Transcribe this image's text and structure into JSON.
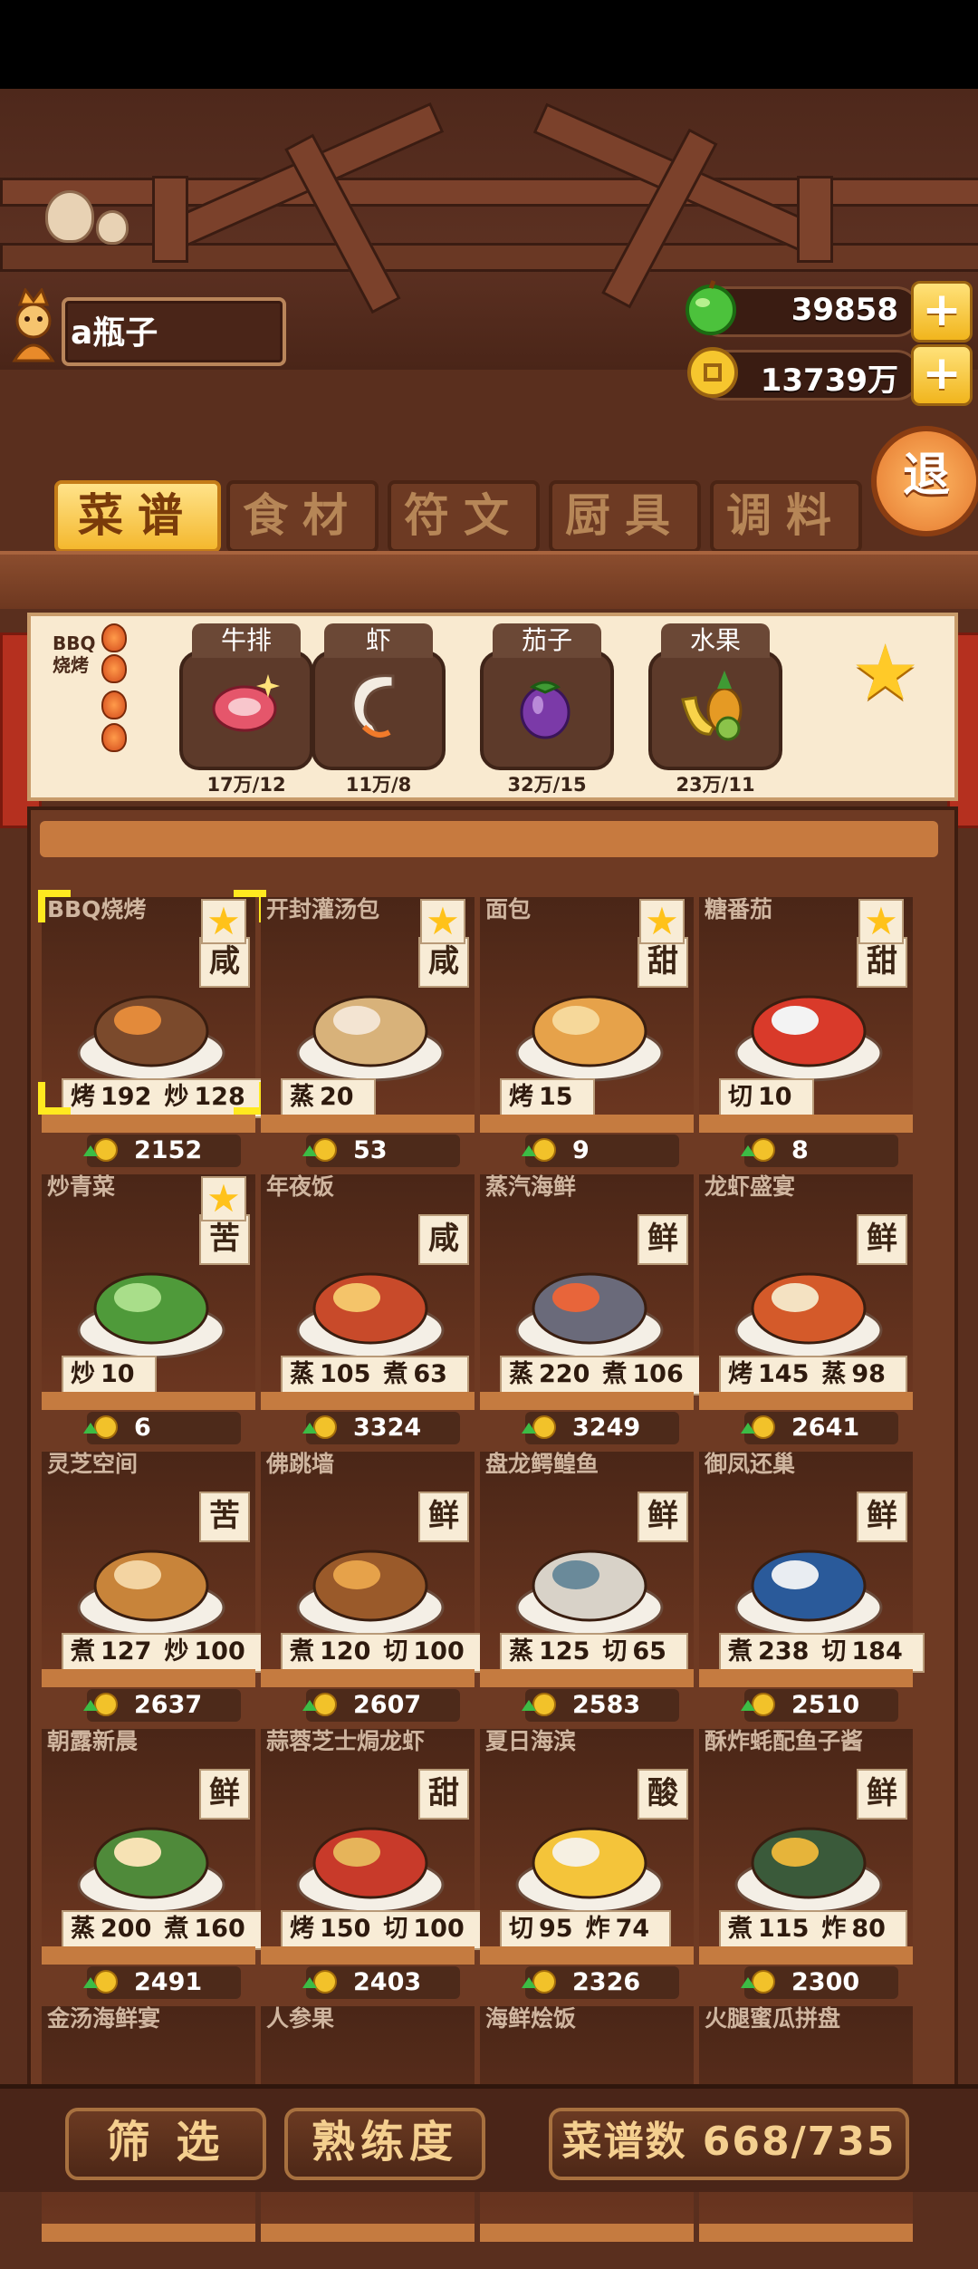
{
  "player": {
    "name": "a瓶子"
  },
  "currencies": {
    "gems": "39858",
    "coins": "13739万"
  },
  "exit_label": "退",
  "tabs": [
    {
      "label": "菜谱",
      "active": true
    },
    {
      "label": "食材",
      "active": false
    },
    {
      "label": "符文",
      "active": false
    },
    {
      "label": "厨具",
      "active": false
    },
    {
      "label": "调料",
      "active": false
    }
  ],
  "ingredient_panel": {
    "title_line1": "BBQ",
    "title_line2": "烧烤",
    "items": [
      {
        "name": "牛排",
        "count": "17万/12",
        "icon": "steak-icon"
      },
      {
        "name": "虾",
        "count": "11万/8",
        "icon": "shrimp-icon"
      },
      {
        "name": "茄子",
        "count": "32万/15",
        "icon": "eggplant-icon"
      },
      {
        "name": "水果",
        "count": "23万/11",
        "icon": "fruit-icon"
      }
    ]
  },
  "recipes": [
    {
      "name": "BBQ烧烤",
      "taste": "咸",
      "star": true,
      "skills": [
        [
          "烤",
          "192"
        ],
        [
          "炒",
          "128"
        ]
      ],
      "price": "2152",
      "selected": true
    },
    {
      "name": "开封灌汤包",
      "taste": "咸",
      "star": true,
      "skills": [
        [
          "蒸",
          "20"
        ]
      ],
      "price": "53"
    },
    {
      "name": "面包",
      "taste": "甜",
      "star": true,
      "skills": [
        [
          "烤",
          "15"
        ]
      ],
      "price": "9"
    },
    {
      "name": "糖番茄",
      "taste": "甜",
      "star": true,
      "skills": [
        [
          "切",
          "10"
        ]
      ],
      "price": "8"
    },
    {
      "name": "炒青菜",
      "taste": "苦",
      "star": true,
      "skills": [
        [
          "炒",
          "10"
        ]
      ],
      "price": "6"
    },
    {
      "name": "年夜饭",
      "taste": "咸",
      "star": false,
      "skills": [
        [
          "蒸",
          "105"
        ],
        [
          "煮",
          "63"
        ]
      ],
      "price": "3324"
    },
    {
      "name": "蒸汽海鲜",
      "taste": "鲜",
      "star": false,
      "skills": [
        [
          "蒸",
          "220"
        ],
        [
          "煮",
          "106"
        ]
      ],
      "price": "3249"
    },
    {
      "name": "龙虾盛宴",
      "taste": "鲜",
      "star": false,
      "skills": [
        [
          "烤",
          "145"
        ],
        [
          "蒸",
          "98"
        ]
      ],
      "price": "2641"
    },
    {
      "name": "灵芝空间",
      "taste": "苦",
      "star": false,
      "skills": [
        [
          "煮",
          "127"
        ],
        [
          "炒",
          "100"
        ]
      ],
      "price": "2637"
    },
    {
      "name": "佛跳墙",
      "taste": "鲜",
      "star": false,
      "skills": [
        [
          "煮",
          "120"
        ],
        [
          "切",
          "100"
        ]
      ],
      "price": "2607"
    },
    {
      "name": "盘龙鳄鳇鱼",
      "taste": "鲜",
      "star": false,
      "skills": [
        [
          "蒸",
          "125"
        ],
        [
          "切",
          "65"
        ]
      ],
      "price": "2583"
    },
    {
      "name": "御凤还巢",
      "taste": "鲜",
      "star": false,
      "skills": [
        [
          "煮",
          "238"
        ],
        [
          "切",
          "184"
        ]
      ],
      "price": "2510"
    },
    {
      "name": "朝露新晨",
      "taste": "鲜",
      "star": false,
      "skills": [
        [
          "蒸",
          "200"
        ],
        [
          "煮",
          "160"
        ]
      ],
      "price": "2491"
    },
    {
      "name": "蒜蓉芝士焗龙虾",
      "taste": "甜",
      "star": false,
      "skills": [
        [
          "烤",
          "150"
        ],
        [
          "切",
          "100"
        ]
      ],
      "price": "2403"
    },
    {
      "name": "夏日海滨",
      "taste": "酸",
      "star": false,
      "skills": [
        [
          "切",
          "95"
        ],
        [
          "炸",
          "74"
        ]
      ],
      "price": "2326"
    },
    {
      "name": "酥炸蚝配鱼子酱",
      "taste": "鲜",
      "star": false,
      "skills": [
        [
          "煮",
          "115"
        ],
        [
          "炸",
          "80"
        ]
      ],
      "price": "2300"
    },
    {
      "name": "金汤海鲜宴"
    },
    {
      "name": "人参果"
    },
    {
      "name": "海鲜烩饭"
    },
    {
      "name": "火腿蜜瓜拼盘"
    }
  ],
  "bottom": {
    "filter_label": "筛 选",
    "proficiency_label": "熟练度",
    "recipe_count": "菜谱数 668/735"
  },
  "colors": {
    "accent": "#f4b82e",
    "wood": "#5a2f1e",
    "card_tag": "#f8ecd6",
    "star": "#ffc21a"
  }
}
